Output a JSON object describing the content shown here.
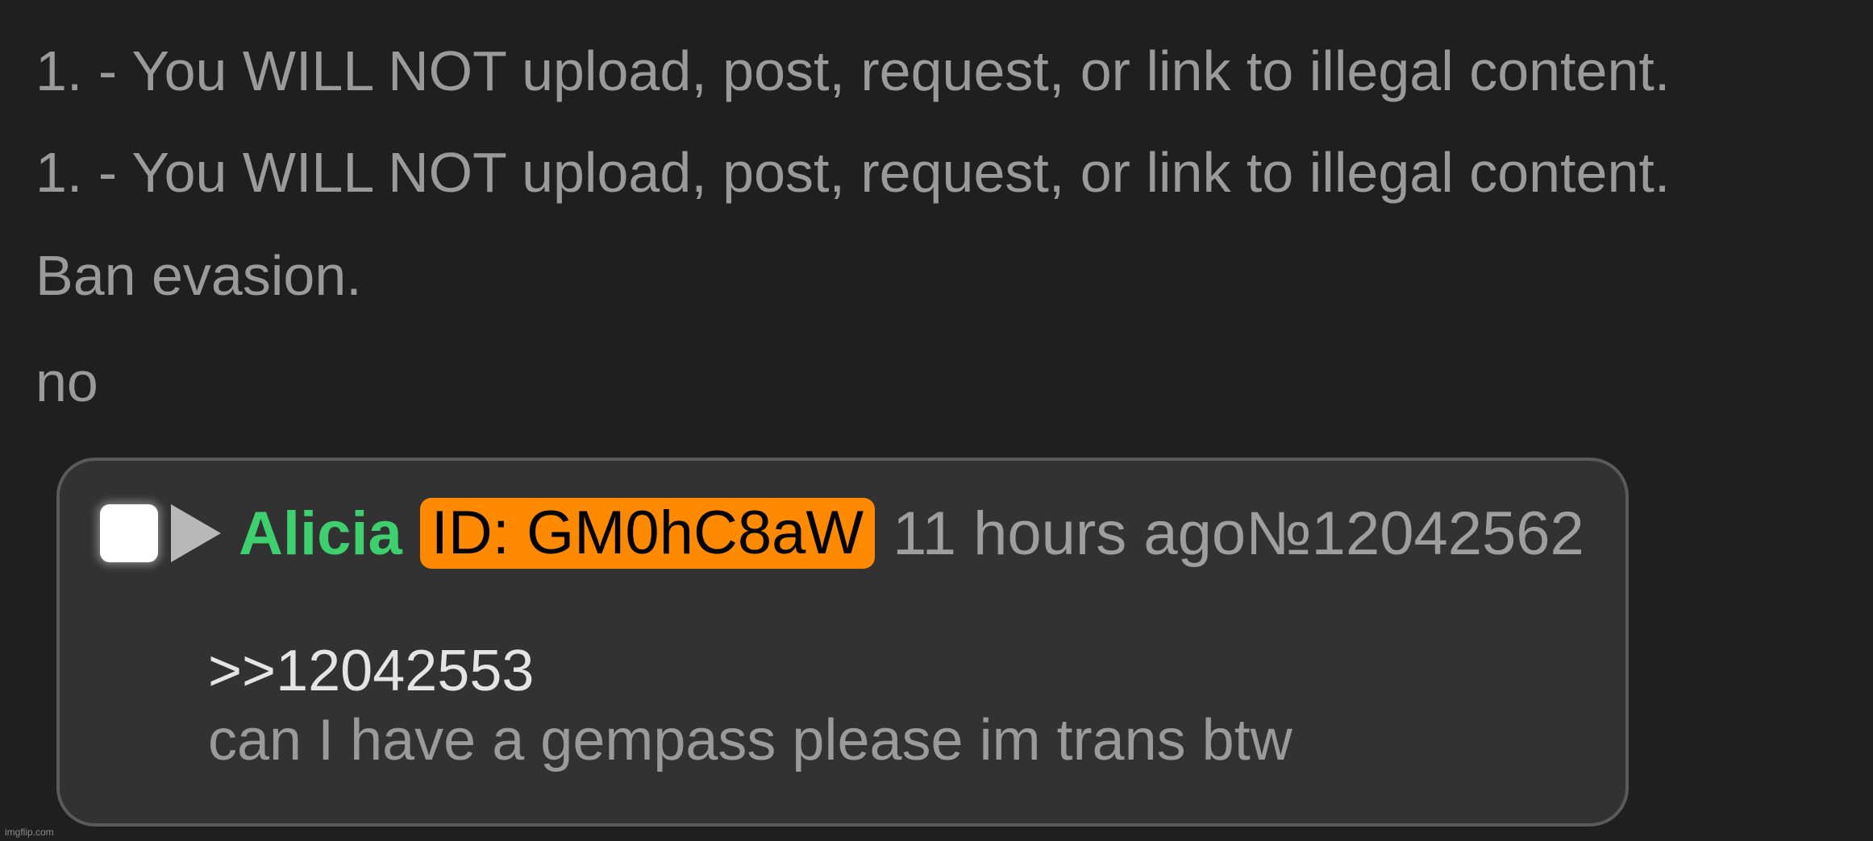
{
  "rules": [
    "1. - You WILL NOT upload, post, request, or link to illegal content.",
    "1. - You WILL NOT upload, post, request, or link to illegal content.",
    "Ban evasion.",
    "no"
  ],
  "post": {
    "name": "Alicia",
    "id_label": "ID: GM0hC8aW",
    "time": "11 hours ago",
    "number": "№12042562",
    "quote": ">>12042553",
    "message": "can I have a gempass please im trans btw"
  },
  "colors": {
    "background": "#1f1f1f",
    "card": "#323232",
    "name": "#3ecf6e",
    "id_badge": "#ff8a00"
  },
  "icons": [
    "checkbox-icon",
    "expand-triangle-icon"
  ],
  "watermark": "imgflip.com"
}
